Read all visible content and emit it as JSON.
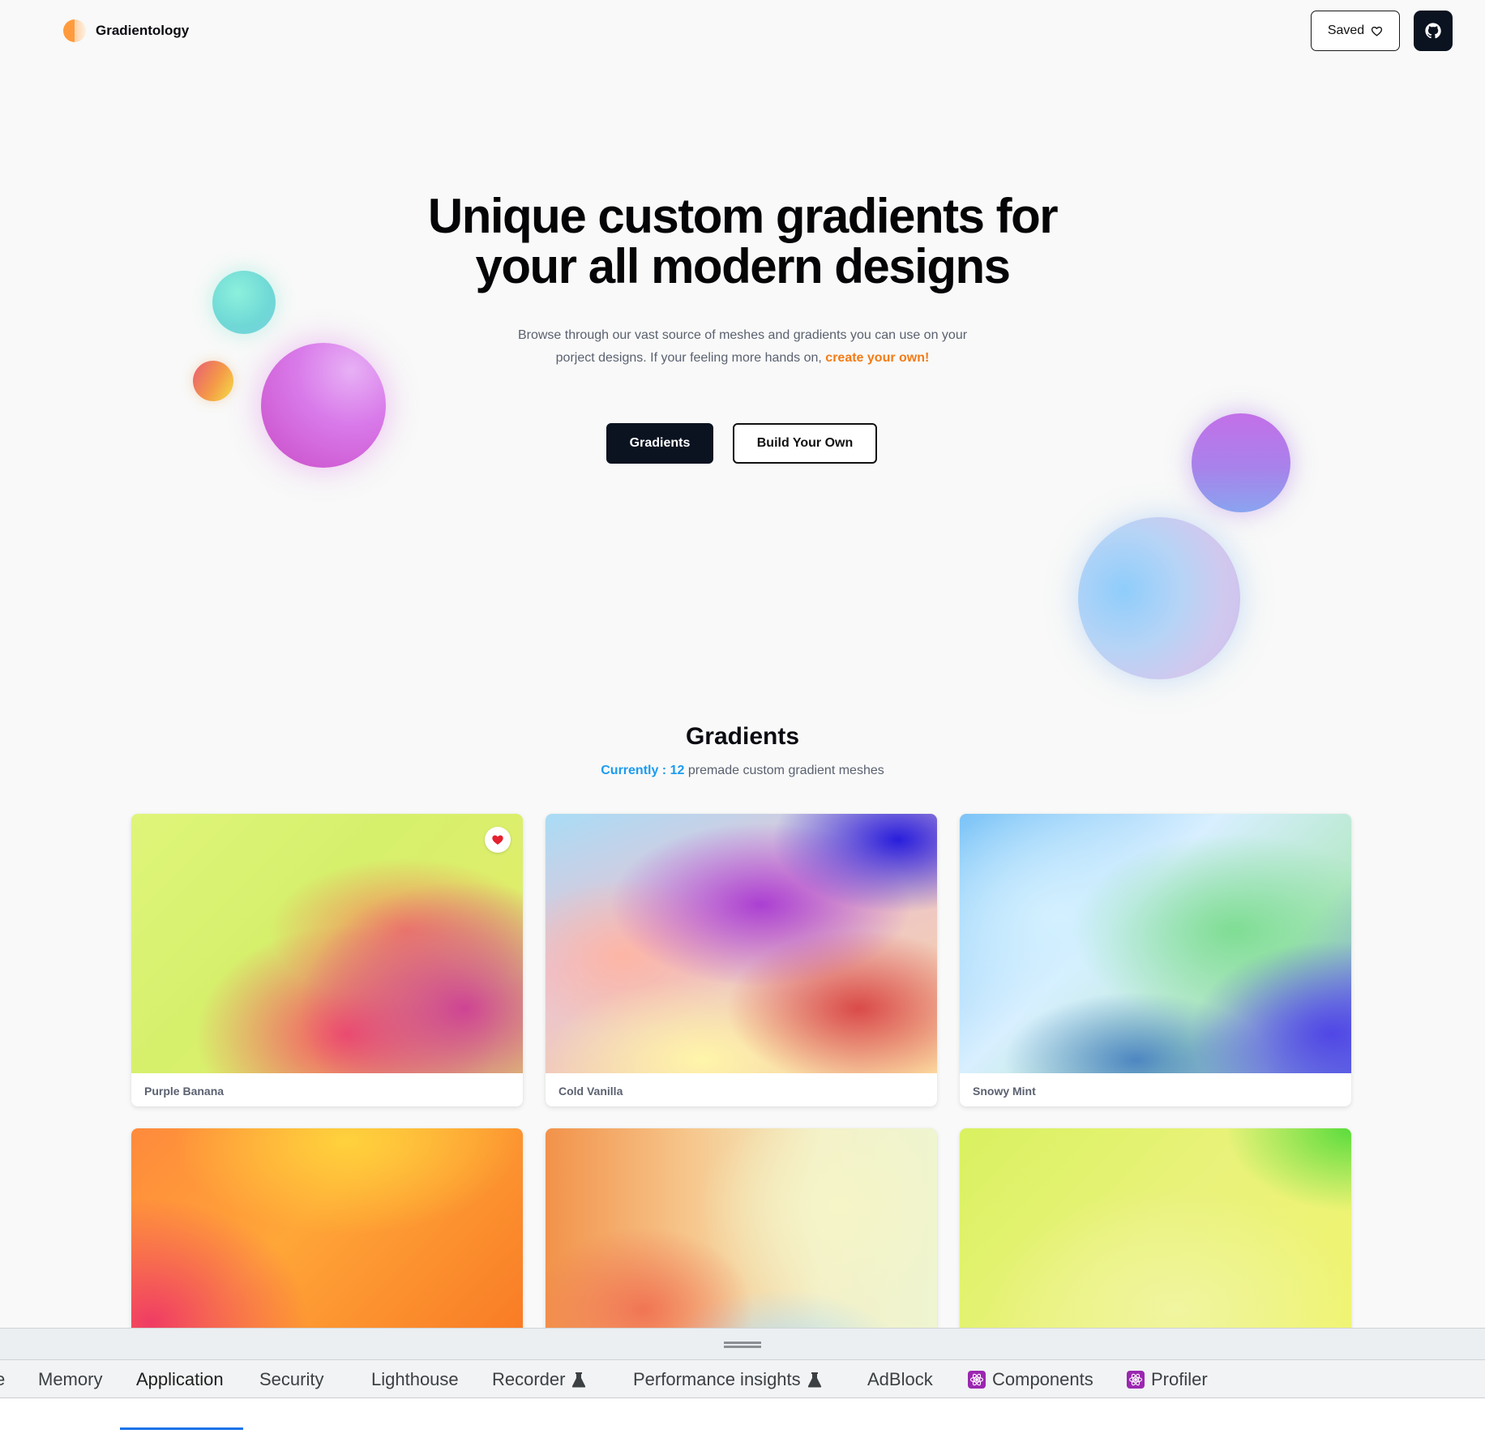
{
  "header": {
    "logo_text": "Gradientology",
    "saved_label": "Saved"
  },
  "hero": {
    "title_line1": "Unique custom gradients for",
    "title_line2": "your all modern designs",
    "desc_line1": "Browse through our vast source of meshes and gradients you can use on your",
    "desc_line2": "porject designs. If your feeling more hands on,",
    "desc_link": "create your own!",
    "btn_primary": "Gradients",
    "btn_secondary": "Build Your Own"
  },
  "gradients": {
    "title": "Gradients",
    "currently_label": "Currently :",
    "count": "12",
    "count_suffix": "premade custom gradient meshes",
    "cards": [
      {
        "name": "Purple Banana",
        "favorited": true
      },
      {
        "name": "Cold Vanilla",
        "favorited": false
      },
      {
        "name": "Snowy Mint",
        "favorited": false
      },
      {
        "name": "",
        "favorited": false
      },
      {
        "name": "",
        "favorited": false
      },
      {
        "name": "",
        "favorited": false
      }
    ]
  },
  "colors": {
    "accent_orange": "#f47b16",
    "accent_blue": "#1d9bf0",
    "dark": "#0b1220",
    "devtools_active": "#1a73e8"
  },
  "devtools": {
    "tabs": [
      {
        "label": "Memory"
      },
      {
        "label": "Application",
        "active": true
      },
      {
        "label": "Security"
      },
      {
        "label": "Lighthouse"
      },
      {
        "label": "Recorder",
        "icon": "flask-icon"
      },
      {
        "label": "Performance insights",
        "icon": "flask-icon"
      },
      {
        "label": "AdBlock"
      },
      {
        "label": "Components",
        "icon": "react-icon"
      },
      {
        "label": "Profiler",
        "icon": "react-icon"
      }
    ]
  }
}
